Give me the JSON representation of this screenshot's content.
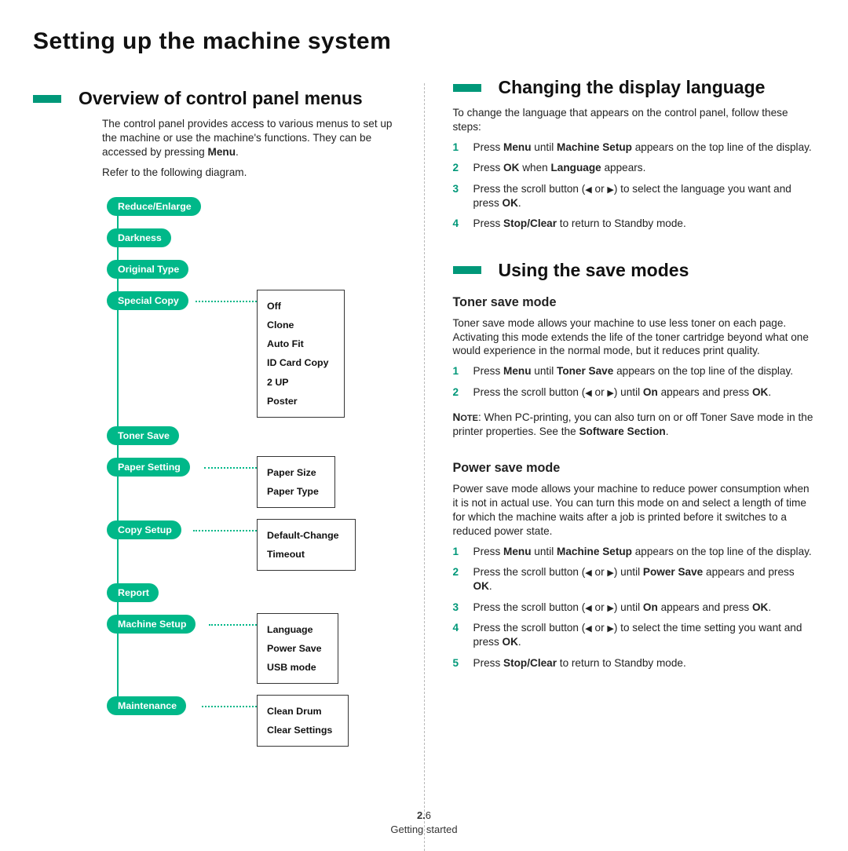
{
  "page_title": "Setting up the machine system",
  "left": {
    "overview": {
      "heading": "Overview of control panel menus",
      "para1_a": "The control panel provides access to various menus to set up the machine or use the machine's functions. They can be accessed by pressing ",
      "para1_b": "Menu",
      "para1_c": ".",
      "para2": "Refer to the following diagram."
    },
    "menu": {
      "pills": {
        "reduce": "Reduce/Enlarge",
        "darkness": "Darkness",
        "original": "Original Type",
        "special": "Special Copy",
        "toner": "Toner Save",
        "paper": "Paper Setting",
        "copy": "Copy Setup",
        "report": "Report",
        "machine": "Machine Setup",
        "maint": "Maintenance"
      },
      "special_items": "Off\nClone\nAuto Fit\nID Card Copy\n2 UP\nPoster",
      "paper_items": "Paper Size\nPaper Type",
      "copy_items": "Default-Change\nTimeout",
      "machine_items": "Language\nPower Save\nUSB mode",
      "maint_items": "Clean Drum\nClear Settings"
    }
  },
  "right": {
    "changelang": {
      "heading": "Changing the display language",
      "intro": "To change the language that appears on the control panel, follow these steps:",
      "steps": {
        "s1a": "Press ",
        "s1b": "Menu",
        "s1c": " until ",
        "s1d": "Machine Setup",
        "s1e": " appears on the top line of the display.",
        "s2a": "Press ",
        "s2b": "OK",
        "s2c": " when ",
        "s2d": "Language",
        "s2e": " appears.",
        "s3a": "Press the scroll button (",
        "s3b": " or ",
        "s3c": ") to select the language you want and press ",
        "s3d": "OK",
        "s3e": ".",
        "s4a": "Press ",
        "s4b": "Stop/Clear",
        "s4c": " to return to Standby mode."
      }
    },
    "savemodes": {
      "heading": "Using the save modes",
      "toner": {
        "sub": "Toner save mode",
        "para": "Toner save mode allows your machine to use less toner on each page. Activating this mode extends the life of the toner cartridge beyond what one would experience in the normal mode, but it reduces print quality.",
        "s1a": "Press ",
        "s1b": "Menu",
        "s1c": " until ",
        "s1d": "Toner Save",
        "s1e": " appears on the top line of the display.",
        "s2a": "Press the scroll button (",
        "s2b": " or ",
        "s2c": ") until ",
        "s2d": "On",
        "s2e": " appears and press ",
        "s2f": "OK",
        "s2g": ".",
        "note_a": "N",
        "note_aa": "OTE",
        "note_b": ": When PC-printing, you can also turn on or off Toner Save mode in the printer properties. See the ",
        "note_c": "Software Section",
        "note_d": "."
      },
      "power": {
        "sub": "Power save mode",
        "para": "Power save mode allows your machine to reduce power consumption when it is not in actual use. You can turn this mode on and select a length of time for which the machine waits after a job is printed before it switches to a reduced power state.",
        "s1a": "Press ",
        "s1b": "Menu",
        "s1c": " until ",
        "s1d": "Machine Setup",
        "s1e": " appears on the top line of the display.",
        "s2a": "Press the scroll button (",
        "s2b": " or ",
        "s2c": ") until ",
        "s2d": "Power Save",
        "s2e": " appears and press ",
        "s2f": "OK",
        "s2g": ".",
        "s3a": "Press the scroll button (",
        "s3b": " or ",
        "s3c": ") until ",
        "s3d": "On",
        "s3e": " appears and press ",
        "s3f": "OK",
        "s3g": ".",
        "s4a": "Press the scroll button (",
        "s4b": " or ",
        "s4c": ") to select the time setting you want and press ",
        "s4d": "OK",
        "s4e": ".",
        "s5a": "Press ",
        "s5b": "Stop/Clear",
        "s5c": " to return to Standby mode."
      }
    }
  },
  "nums": {
    "n1": "1",
    "n2": "2",
    "n3": "3",
    "n4": "4",
    "n5": "5"
  },
  "footer": {
    "chapter": "2.",
    "page": "6",
    "section": "Getting started"
  }
}
